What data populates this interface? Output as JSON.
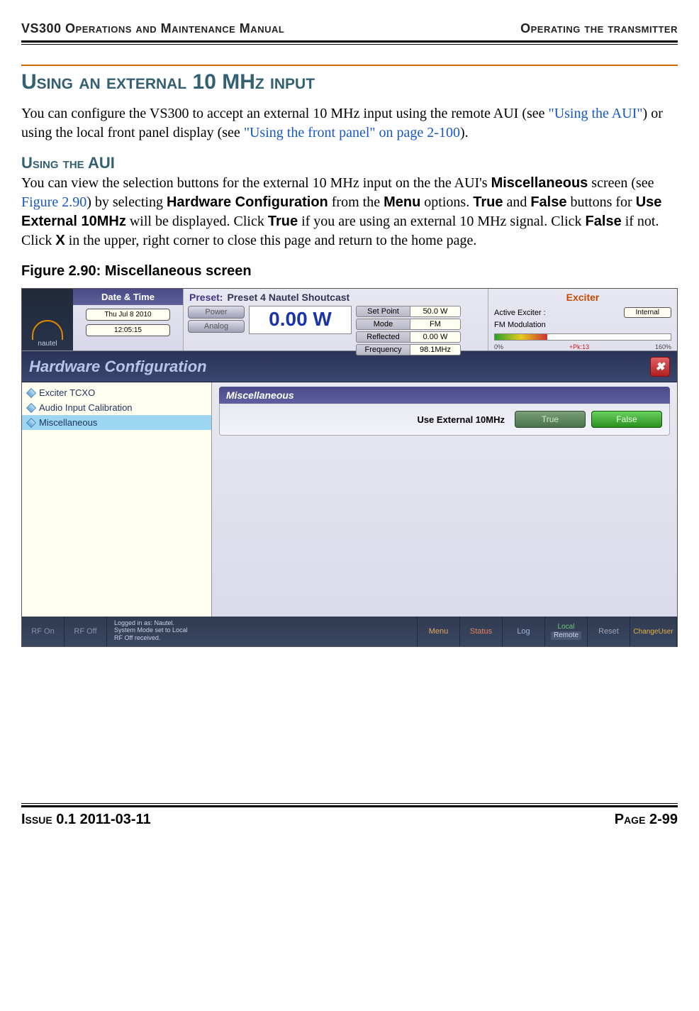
{
  "header": {
    "left": "VS300 Operations and Maintenance Manual",
    "right": "Operating the transmitter"
  },
  "section_title": "Using an external 10 MHz input",
  "para1_a": "You can configure the VS300 to accept an external 10 MHz input using the remote AUI (see ",
  "para1_link1": "\"Using the AUI\"",
  "para1_b": ") or using the local front panel display (see ",
  "para1_link2": "\"Using the front panel\" on page 2-100",
  "para1_c": ").",
  "subsection_title": "Using the AUI",
  "para2_a": "You can view the selection buttons for the external 10 MHz input on the the AUI's ",
  "para2_b": " screen (see ",
  "para2_link": "Figure 2.90",
  "para2_c": ") by selecting ",
  "para2_d": " from the ",
  "para2_e": " options. ",
  "para2_f": " and ",
  "para2_g": " buttons for ",
  "para2_h": " will be displayed. Click ",
  "para2_i": " if you are using an external 10 MHz signal. Click ",
  "para2_j": " if not. Click ",
  "para2_k": " in the upper, right corner to close this page and return to the home page.",
  "ui_terms": {
    "misc": "Miscellaneous",
    "hwconfig": "Hardware Configuration",
    "menu": "Menu",
    "true": "True",
    "false": "False",
    "use_ext": "Use External 10MHz",
    "x": "X"
  },
  "fig_caption": "Figure 2.90: Miscellaneous screen",
  "screenshot": {
    "logo_text": "nautel",
    "datetime": {
      "header": "Date & Time",
      "date": "Thu Jul 8 2010",
      "time": "12:05:15"
    },
    "preset_label": "Preset:",
    "preset_value": "Preset 4 Nautel Shoutcast",
    "power_btn": "Power",
    "analog_btn": "Analog",
    "power_value": "0.00 W",
    "params": {
      "setpoint_k": "Set Point",
      "setpoint_v": "50.0 W",
      "mode_k": "Mode",
      "mode_v": "FM",
      "reflected_k": "Reflected",
      "reflected_v": "0.00 W",
      "freq_k": "Frequency",
      "freq_v": "98.1MHz"
    },
    "exciter": {
      "title": "Exciter",
      "active_label": "Active Exciter :",
      "active_value": "Internal",
      "fm_mod": "FM Modulation",
      "tick0": "0%",
      "tickpk": "+Pk:13",
      "tick160": "160%"
    },
    "titlebar": "Hardware Configuration",
    "close": "✖",
    "sidebar": {
      "item1": "Exciter TCXO",
      "item2": "Audio Input Calibration",
      "item3": "Miscellaneous"
    },
    "panel_title": "Miscellaneous",
    "option_label": "Use External 10MHz",
    "btn_true": "True",
    "btn_false": "False",
    "footer": {
      "rfon": "RF On",
      "rfoff": "RF Off",
      "info1": "Logged in as:    Nautel.",
      "info2": "System Mode set to Local",
      "info3": "RF Off received.",
      "menu": "Menu",
      "status": "Status",
      "log": "Log",
      "local": "Local",
      "remote": "Remote",
      "reset": "Reset",
      "chuser1": "Change",
      "chuser2": "User"
    }
  },
  "page_footer": {
    "left": "Issue 0.1  2011-03-11",
    "right": "Page 2-99"
  }
}
